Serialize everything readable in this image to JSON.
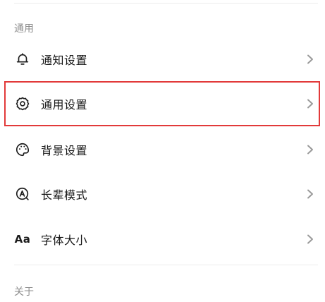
{
  "sections": {
    "general": {
      "label": "通用"
    },
    "about": {
      "label": "关于"
    }
  },
  "items": [
    {
      "label": "通知设置",
      "icon": "bell-icon",
      "selected": false
    },
    {
      "label": "通用设置",
      "icon": "gear-icon",
      "selected": true
    },
    {
      "label": "背景设置",
      "icon": "palette-icon",
      "selected": false
    },
    {
      "label": "长辈模式",
      "icon": "elder-mode-icon",
      "selected": false
    },
    {
      "label": "字体大小",
      "icon": "font-size-icon",
      "icon_text": "Aa",
      "selected": false
    }
  ],
  "colors": {
    "highlight": "#e23a3a",
    "section_label": "#8e8e8e",
    "chevron": "#9a9a9a"
  }
}
